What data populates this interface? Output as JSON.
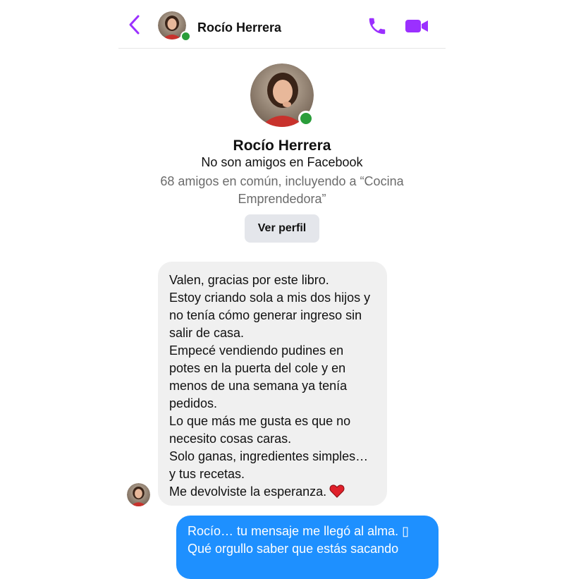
{
  "colors": {
    "accent": "#9b30ff",
    "online": "#2a9d3a",
    "incoming_bubble": "#f0f0f0",
    "outgoing_bubble": "#1e90ff"
  },
  "header": {
    "back_icon": "chevron-left-icon",
    "name": "Rocío Herrera",
    "call_icon": "phone-icon",
    "video_icon": "video-camera-icon"
  },
  "profile": {
    "name": "Rocío Herrera",
    "status": "No son amigos en Facebook",
    "mutual": "68 amigos en común, incluyendo a “Cocina Emprendedora”",
    "view_button": "Ver perfil"
  },
  "messages": {
    "incoming": [
      "Valen, gracias por este libro.",
      "Estoy criando sola a mis dos hijos y",
      "no tenía cómo generar ingreso sin",
      "salir de casa.",
      "Empecé vendiendo pudines en",
      "potes en la puerta del cole y en",
      "menos de una semana ya tenía",
      "pedidos.",
      "Lo que más me gusta es que no",
      "necesito cosas caras.",
      "Solo ganas, ingredientes simples…",
      "y tus recetas.",
      "Me devolviste la esperanza."
    ],
    "incoming_emoji": "heart-icon",
    "outgoing": [
      "Rocío… tu mensaje me llegó al alma. ▯",
      "Qué orgullo saber que estás sacando"
    ]
  }
}
